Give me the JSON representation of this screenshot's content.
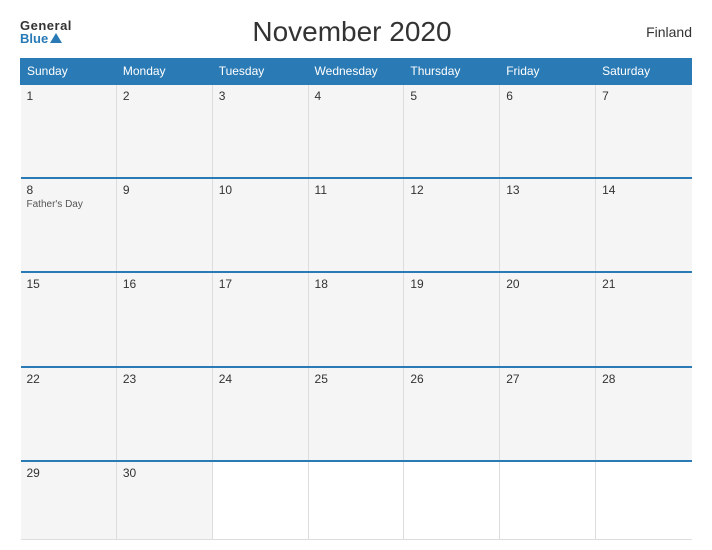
{
  "header": {
    "logo_general": "General",
    "logo_blue": "Blue",
    "title": "November 2020",
    "country": "Finland"
  },
  "calendar": {
    "days_of_week": [
      "Sunday",
      "Monday",
      "Tuesday",
      "Wednesday",
      "Thursday",
      "Friday",
      "Saturday"
    ],
    "weeks": [
      [
        {
          "day": "1",
          "event": ""
        },
        {
          "day": "2",
          "event": ""
        },
        {
          "day": "3",
          "event": ""
        },
        {
          "day": "4",
          "event": ""
        },
        {
          "day": "5",
          "event": ""
        },
        {
          "day": "6",
          "event": ""
        },
        {
          "day": "7",
          "event": ""
        }
      ],
      [
        {
          "day": "8",
          "event": "Father's Day"
        },
        {
          "day": "9",
          "event": ""
        },
        {
          "day": "10",
          "event": ""
        },
        {
          "day": "11",
          "event": ""
        },
        {
          "day": "12",
          "event": ""
        },
        {
          "day": "13",
          "event": ""
        },
        {
          "day": "14",
          "event": ""
        }
      ],
      [
        {
          "day": "15",
          "event": ""
        },
        {
          "day": "16",
          "event": ""
        },
        {
          "day": "17",
          "event": ""
        },
        {
          "day": "18",
          "event": ""
        },
        {
          "day": "19",
          "event": ""
        },
        {
          "day": "20",
          "event": ""
        },
        {
          "day": "21",
          "event": ""
        }
      ],
      [
        {
          "day": "22",
          "event": ""
        },
        {
          "day": "23",
          "event": ""
        },
        {
          "day": "24",
          "event": ""
        },
        {
          "day": "25",
          "event": ""
        },
        {
          "day": "26",
          "event": ""
        },
        {
          "day": "27",
          "event": ""
        },
        {
          "day": "28",
          "event": ""
        }
      ],
      [
        {
          "day": "29",
          "event": ""
        },
        {
          "day": "30",
          "event": ""
        },
        {
          "day": "",
          "event": ""
        },
        {
          "day": "",
          "event": ""
        },
        {
          "day": "",
          "event": ""
        },
        {
          "day": "",
          "event": ""
        },
        {
          "day": "",
          "event": ""
        }
      ]
    ]
  }
}
